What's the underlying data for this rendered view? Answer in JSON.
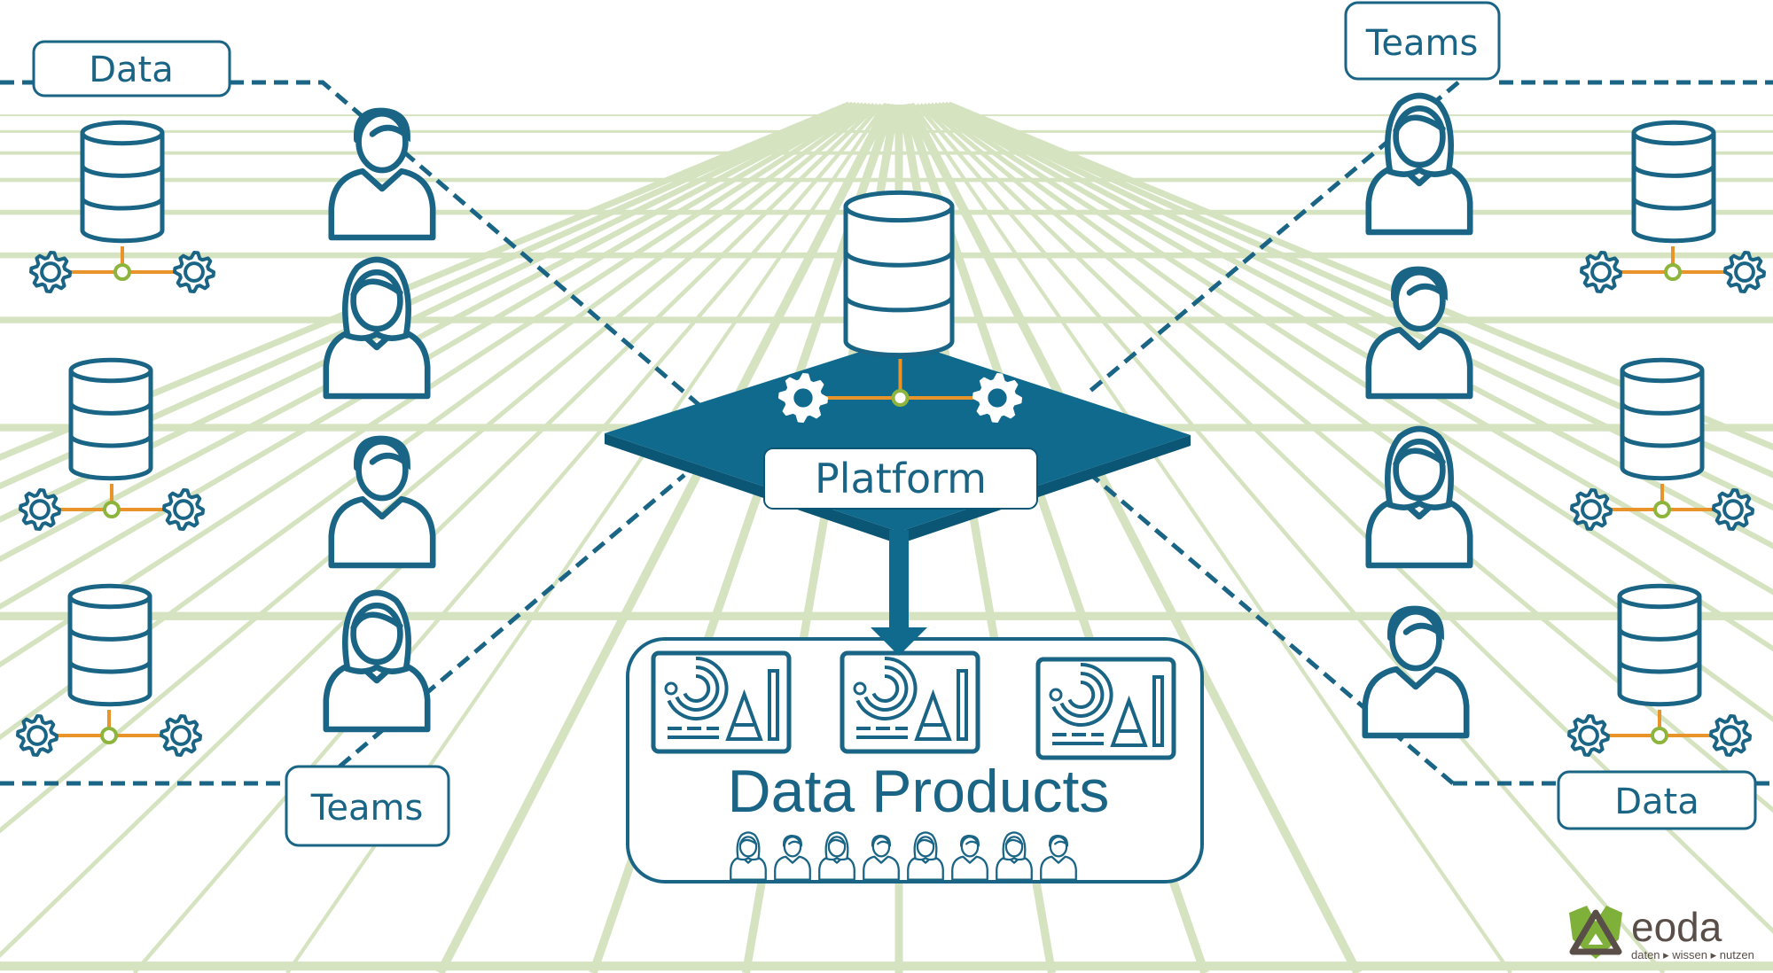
{
  "labels": {
    "data_top_left": "Data",
    "teams_top_right": "Teams",
    "teams_bottom_left": "Teams",
    "data_bottom_right": "Data",
    "platform": "Platform",
    "data_products": "Data Products"
  },
  "logo": {
    "name": "eoda",
    "tagline": "daten ▸ wissen ▸ nutzen"
  },
  "icons": {
    "database": "database-icon",
    "gear": "gear-icon",
    "person": "person-icon",
    "dashboard": "dashboard-icon"
  },
  "colors": {
    "primary": "#1a6585",
    "platform": "#0f6a8e",
    "connector": "#e8942a",
    "node": "#8db43c",
    "grid": "#d6e3c0",
    "logo_green": "#7fb03a",
    "logo_brown": "#5a4e48"
  }
}
